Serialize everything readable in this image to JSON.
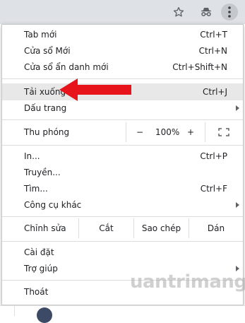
{
  "menu": {
    "new_tab": {
      "label": "Tab mới",
      "shortcut": "Ctrl+T"
    },
    "new_window": {
      "label": "Cửa sổ Mới",
      "shortcut": "Ctrl+N"
    },
    "incognito": {
      "label": "Cửa sổ ẩn danh mới",
      "shortcut": "Ctrl+Shift+N"
    },
    "downloads": {
      "label": "Tải xuống",
      "shortcut": "Ctrl+J"
    },
    "bookmarks": {
      "label": "Dấu trang"
    },
    "zoom": {
      "label": "Thu phóng",
      "minus": "−",
      "value": "100%",
      "plus": "+"
    },
    "print": {
      "label": "In...",
      "shortcut": "Ctrl+P"
    },
    "cast": {
      "label": "Truyền..."
    },
    "find": {
      "label": "Tìm...",
      "shortcut": "Ctrl+F"
    },
    "more_tools": {
      "label": "Công cụ khác"
    },
    "edit": {
      "label": "Chỉnh sửa",
      "cut": "Cắt",
      "copy": "Sao chép",
      "paste": "Dán"
    },
    "settings": {
      "label": "Cài đặt"
    },
    "help": {
      "label": "Trợ giúp"
    },
    "exit": {
      "label": "Thoát"
    }
  },
  "toolbar": {
    "icons": [
      "star-icon",
      "incognito-icon",
      "more-vert-icon"
    ]
  },
  "watermark": "uantrimang",
  "colors": {
    "accent_arrow": "#e8141b",
    "toolbar_bg": "#dee1e6",
    "highlight": "#e8e8e8"
  }
}
